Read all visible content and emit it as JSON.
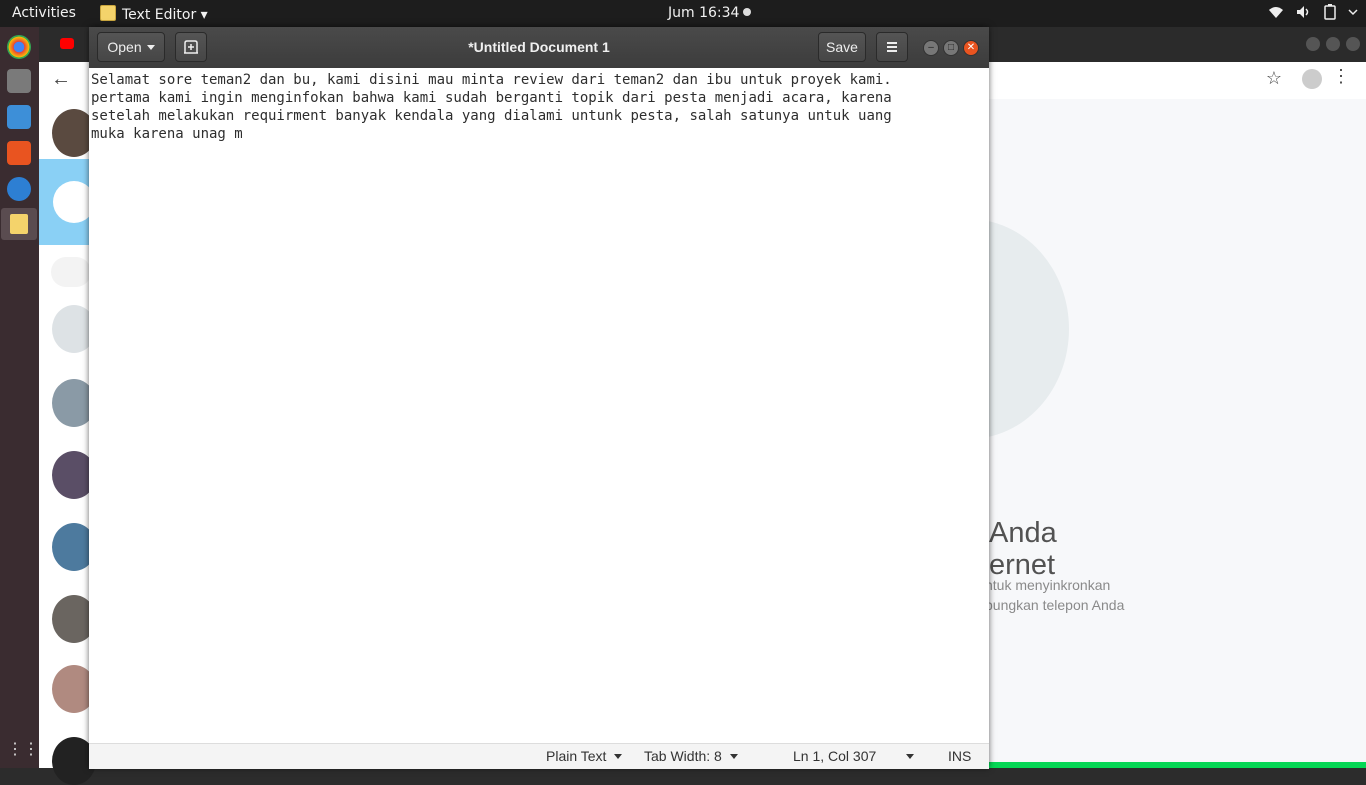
{
  "topbar": {
    "activities": "Activities",
    "app_menu": "Text Editor ▾",
    "clock": "Jum 16:34",
    "tray_icons": [
      "wifi-icon",
      "volume-icon",
      "battery-icon",
      "system-menu-icon"
    ]
  },
  "dock": {
    "items": [
      "chrome-icon",
      "files-icon",
      "writer-icon",
      "software-icon",
      "help-icon",
      "text-editor-icon",
      "apps-grid-icon"
    ]
  },
  "browser": {
    "toolbar_icons": [
      "back-icon",
      "star-icon",
      "account-icon",
      "menu-icon"
    ],
    "heading": "Anda\nernet",
    "paragraph": "ntuk menyinkronkan\npungkan telepon Anda"
  },
  "gedit": {
    "title": "*Untitled Document 1",
    "open_label": "Open",
    "save_label": "Save",
    "content": "Selamat sore teman2 dan bu, kami disini mau minta review dari teman2 dan ibu untuk proyek kami.\npertama kami ingin menginfokan bahwa kami sudah berganti topik dari pesta menjadi acara, karena\nsetelah melakukan requirment banyak kendala yang dialami untunk pesta, salah satunya untuk uang\nmuka karena unag m",
    "status": {
      "language": "Plain Text",
      "tab_width": "Tab Width: 8",
      "position": "Ln 1, Col 307",
      "mode": "INS"
    }
  }
}
